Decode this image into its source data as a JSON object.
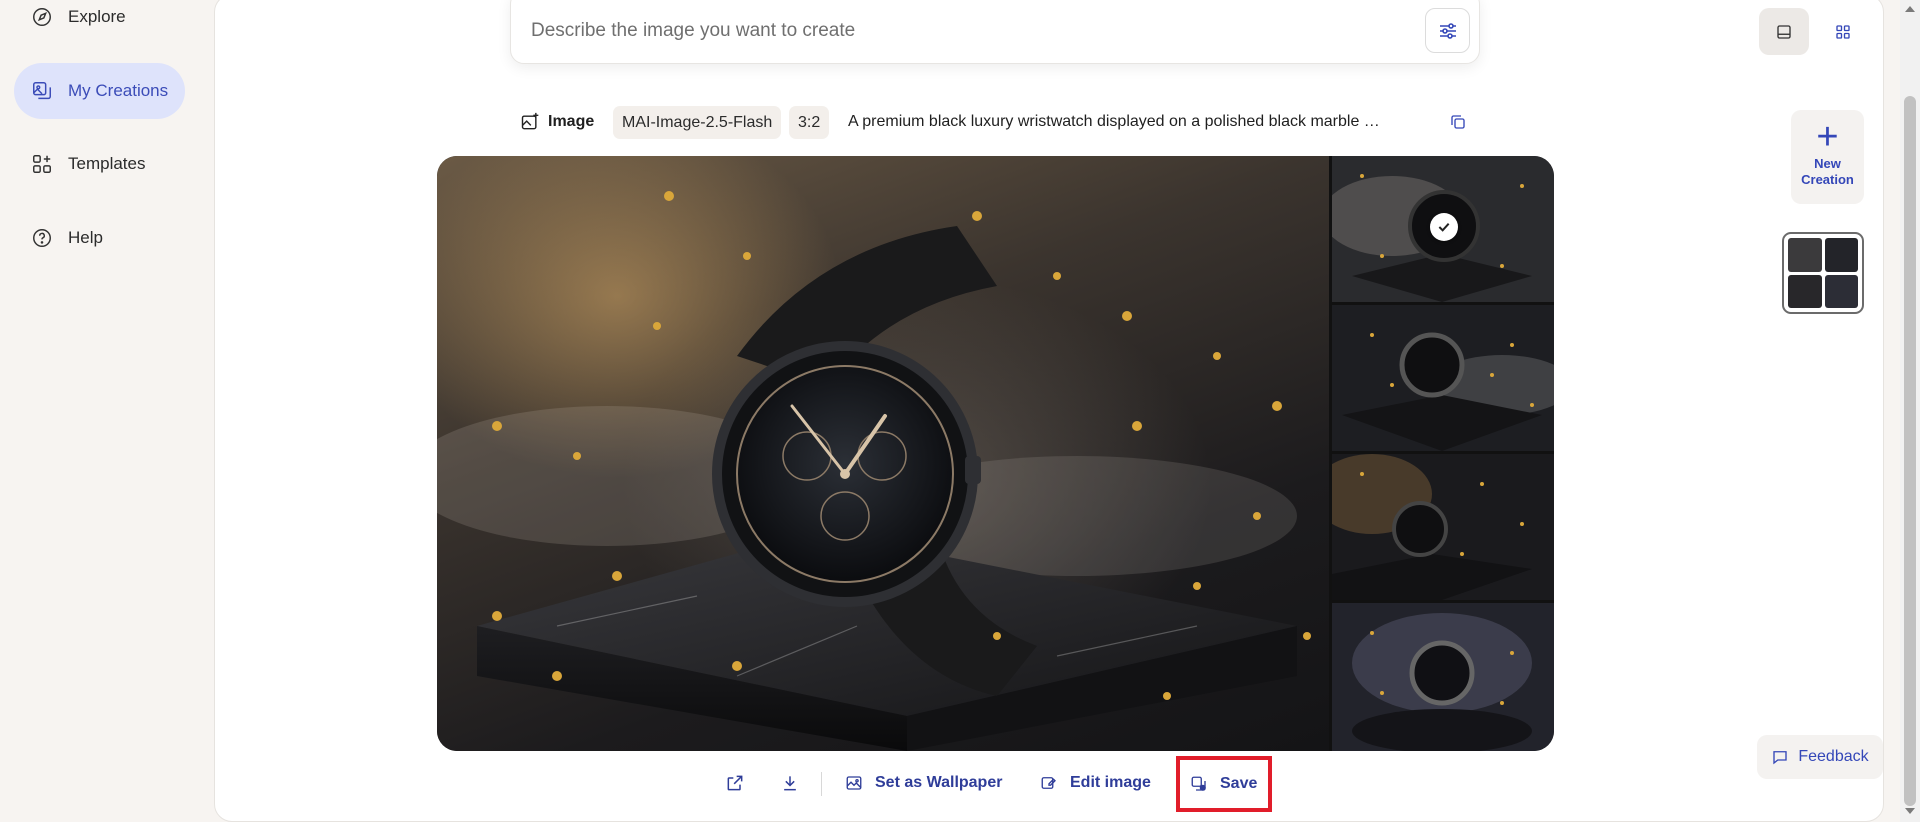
{
  "sidebar": {
    "items": [
      {
        "label": "Explore",
        "icon": "compass-icon",
        "active": false
      },
      {
        "label": "My Creations",
        "icon": "images-icon",
        "active": true
      },
      {
        "label": "Templates",
        "icon": "templates-icon",
        "active": false
      },
      {
        "label": "Help",
        "icon": "help-icon",
        "active": false
      }
    ]
  },
  "prompt": {
    "placeholder": "Describe the image you want to create",
    "value": ""
  },
  "meta": {
    "type_label": "Image",
    "model": "MAI-Image-2.5-Flash",
    "aspect_ratio": "3:2",
    "prompt_text": "A premium black luxury wristwatch displayed on a polished black marble …"
  },
  "actions": {
    "share_icon": "share-icon",
    "download_icon": "download-icon",
    "wallpaper_label": "Set as Wallpaper",
    "edit_label": "Edit image",
    "save_label": "Save"
  },
  "right_rail": {
    "new_creation_line1": "New",
    "new_creation_line2": "Creation",
    "feedback_label": "Feedback"
  },
  "colors": {
    "accent": "#3447b8",
    "active_nav_bg": "#dee3fb",
    "highlight_border": "#e11d2a"
  }
}
